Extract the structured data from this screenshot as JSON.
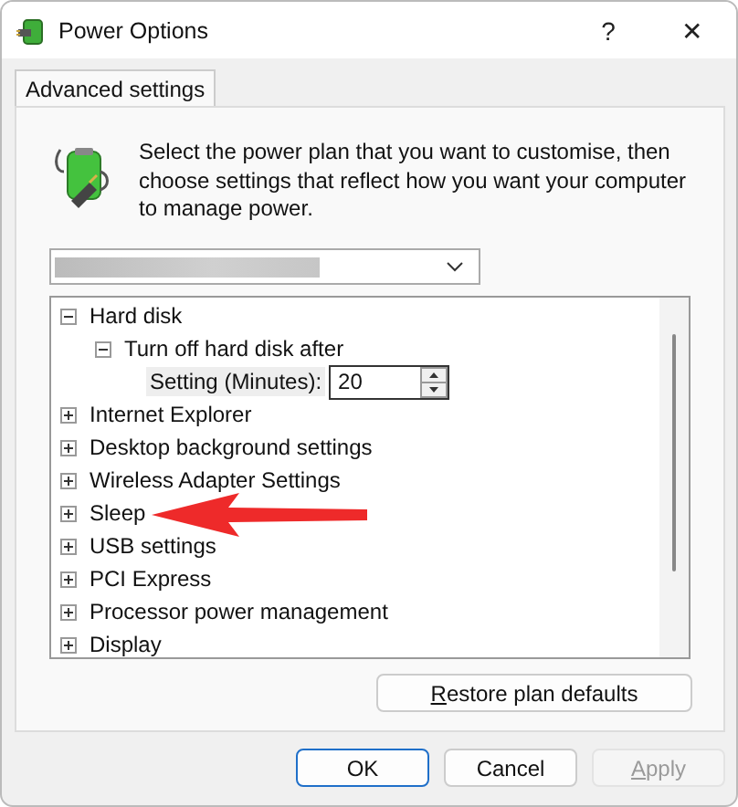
{
  "window": {
    "title": "Power Options",
    "help": "?",
    "close": "✕"
  },
  "tabs": [
    {
      "label": "Advanced settings",
      "selected": true
    }
  ],
  "intro": "Select the power plan that you want to customise, then choose settings that reflect how you want your computer to manage power.",
  "plan_dropdown": {
    "redacted": true
  },
  "tree": [
    {
      "kind": "group",
      "label": "Hard disk",
      "expanded": true,
      "children": [
        {
          "kind": "group",
          "label": "Turn off hard disk after",
          "expanded": true,
          "children": [
            {
              "kind": "setting",
              "label": "Setting (Minutes):",
              "value": "20"
            }
          ]
        }
      ]
    },
    {
      "kind": "group",
      "label": "Internet Explorer",
      "expanded": false
    },
    {
      "kind": "group",
      "label": "Desktop background settings",
      "expanded": false
    },
    {
      "kind": "group",
      "label": "Wireless Adapter Settings",
      "expanded": false
    },
    {
      "kind": "group",
      "label": "Sleep",
      "expanded": false
    },
    {
      "kind": "group",
      "label": "USB settings",
      "expanded": false
    },
    {
      "kind": "group",
      "label": "PCI Express",
      "expanded": false
    },
    {
      "kind": "group",
      "label": "Processor power management",
      "expanded": false
    },
    {
      "kind": "group",
      "label": "Display",
      "expanded": false
    }
  ],
  "restore_button": {
    "label": "Restore plan defaults",
    "mnemonic": true
  },
  "buttons": [
    {
      "label": "OK",
      "default": true,
      "disabled": false,
      "mnemonic": false
    },
    {
      "label": "Cancel",
      "default": false,
      "disabled": false,
      "mnemonic": false
    },
    {
      "label": "Apply",
      "default": false,
      "disabled": true,
      "mnemonic": true
    }
  ]
}
